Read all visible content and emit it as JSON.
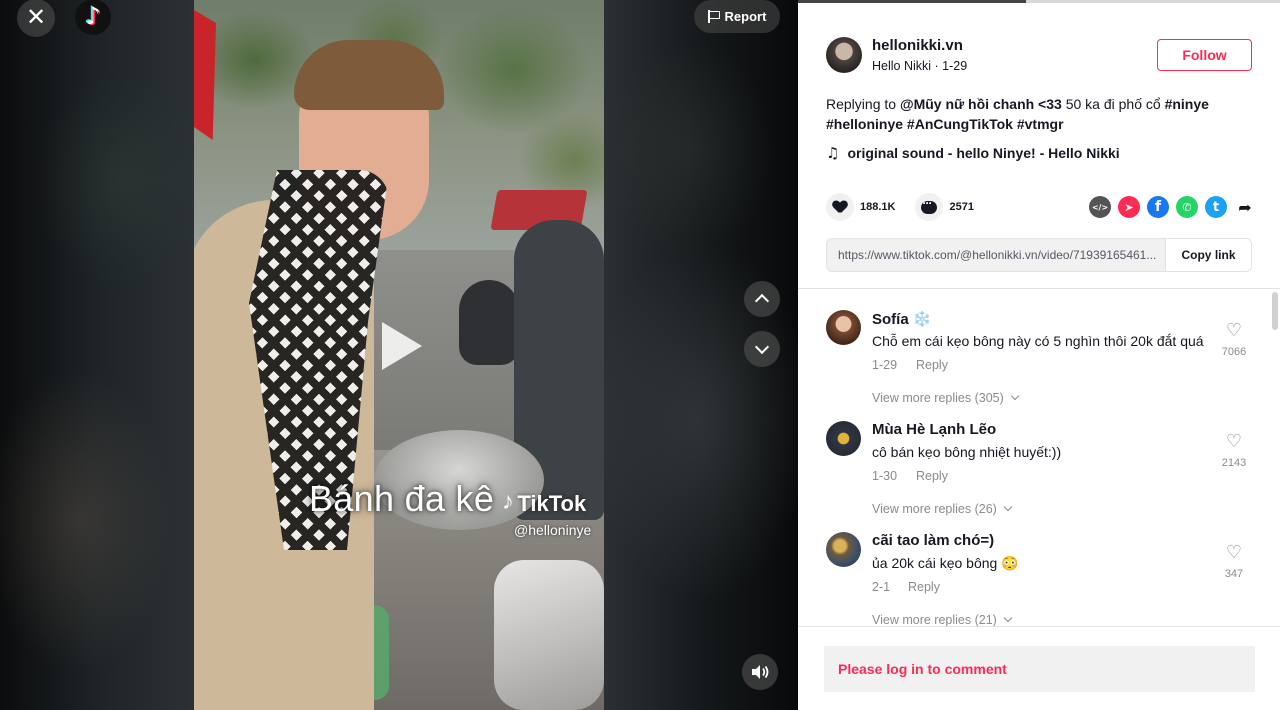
{
  "video": {
    "overlay_caption": "Bánh đa kê",
    "watermark_brand": "TikTok",
    "watermark_handle": "@helloninye",
    "report_label": "Report",
    "close_glyph": "✕",
    "logo_glyph": "♪"
  },
  "author": {
    "username": "hellonikki.vn",
    "subline": "Hello Nikki · 1-29",
    "follow_label": "Follow"
  },
  "description": {
    "prefix": "Replying to ",
    "mention": "@Mũy nữ hồi chanh <33",
    "text": " 50 ka đi phố cổ ",
    "tag1": "#ninye",
    "tag2": "#helloninye",
    "tag3": "#AnCungTikTok",
    "tag4": "#vtmgr"
  },
  "music": {
    "icon": "♫",
    "title": "original sound - hello Ninye! - Hello Nikki"
  },
  "stats": {
    "likes": "188.1K",
    "comments": "2571"
  },
  "share": {
    "icons": [
      "embed-icon",
      "send-icon",
      "facebook-icon",
      "whatsapp-icon",
      "twitter-icon",
      "share-arrow-icon"
    ],
    "embed_glyph": "</>",
    "send_glyph": "➤",
    "facebook_glyph": "f",
    "whatsapp_glyph": "✆",
    "twitter_glyph": "t",
    "arrow_glyph": "➦",
    "colors": {
      "send": "#fe2c55",
      "facebook": "#1877f2",
      "whatsapp": "#25d366",
      "twitter": "#1da1f2",
      "embed": "#545454"
    }
  },
  "link": {
    "url": "https://www.tiktok.com/@hellonikki.vn/video/71939165461...",
    "copy_label": "Copy link"
  },
  "comments": [
    {
      "name": "Sofía ❄️",
      "text": "Chỗ em cái kẹo bông này có 5 nghìn thôi 20k đắt quá",
      "date": "1-29",
      "reply": "Reply",
      "likes": "7066",
      "more": "View more replies (305)"
    },
    {
      "name": "Mùa Hè Lạnh Lẽo",
      "text": "cô bán kẹo bông nhiệt huyết:))",
      "date": "1-30",
      "reply": "Reply",
      "likes": "2143",
      "more": "View more replies (26)"
    },
    {
      "name": "cãi tao làm chó=)",
      "text": "ủa 20k cái kẹo bông 😳",
      "date": "2-1",
      "reply": "Reply",
      "likes": "347",
      "more": "View more replies (21)"
    }
  ],
  "login": {
    "prompt": "Please log in to comment"
  },
  "colors": {
    "accent": "#fe2c55",
    "text_primary": "#161823",
    "text_secondary": "#8a8b91"
  }
}
